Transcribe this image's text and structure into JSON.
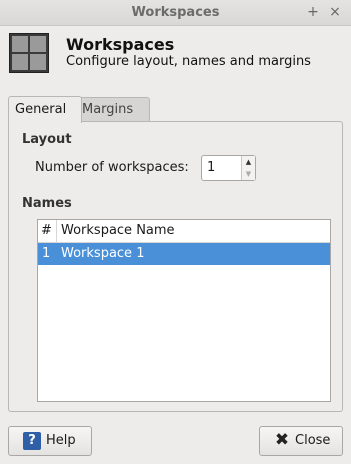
{
  "window": {
    "title": "Workspaces",
    "pin_glyph": "+",
    "close_glyph": "×"
  },
  "header": {
    "icon": "workspaces-icon",
    "title": "Workspaces",
    "subtitle": "Configure layout, names and margins"
  },
  "tabs": [
    {
      "label": "General",
      "active": true
    },
    {
      "label": "Margins",
      "active": false
    }
  ],
  "layout": {
    "section_title": "Layout",
    "workspaces_label": "Number of workspaces:",
    "workspaces_value": "1"
  },
  "names": {
    "section_title": "Names",
    "columns": [
      "#",
      "Workspace Name"
    ],
    "rows": [
      {
        "index": "1",
        "name": "Workspace 1",
        "selected": true
      }
    ]
  },
  "buttons": {
    "help": "Help",
    "close": "Close"
  },
  "colors": {
    "selection": "#4a90d9",
    "help_icon": "#2f5fa6"
  }
}
